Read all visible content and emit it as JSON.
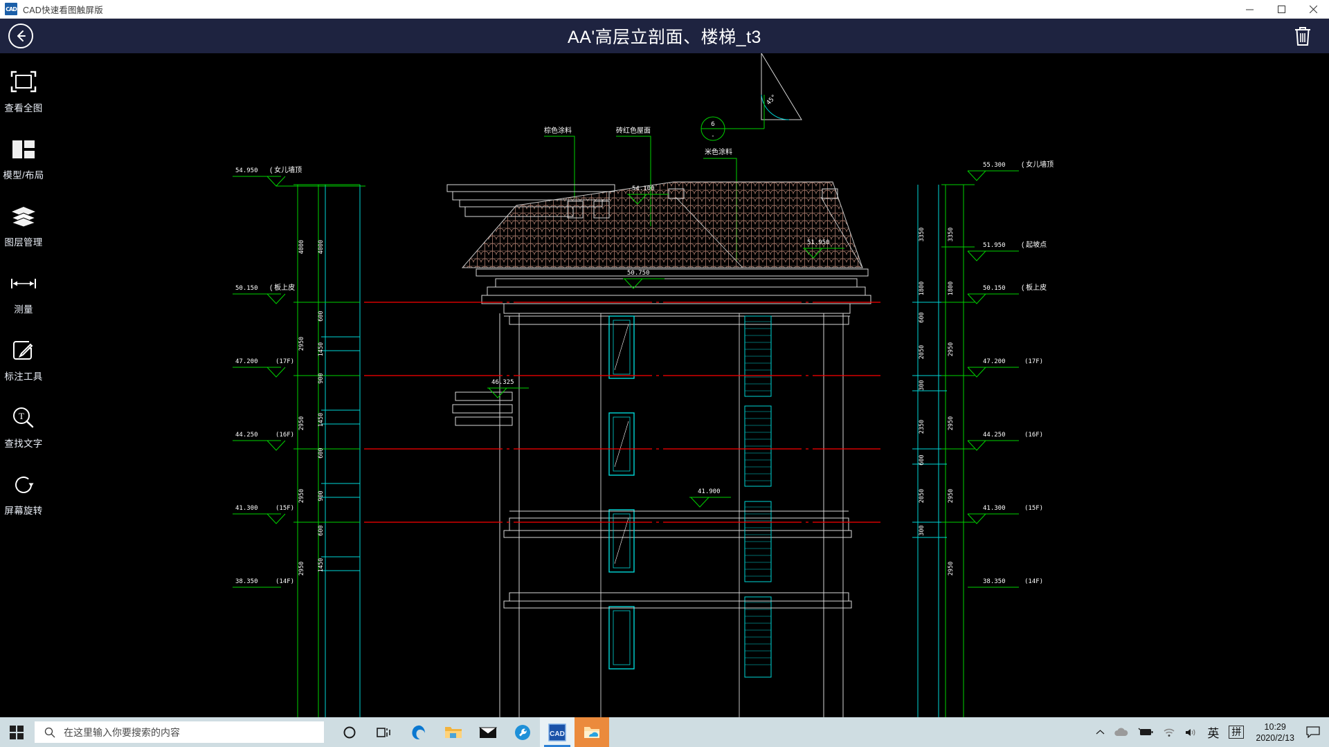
{
  "window": {
    "app_icon": "cad-app-icon",
    "title": "CAD快速看图触屏版",
    "minimize": "─",
    "maximize": "□",
    "close": "✕"
  },
  "header": {
    "back_icon": "back-arrow-icon",
    "title": "AA'高层立剖面、楼梯_t3",
    "delete_icon": "trash-icon"
  },
  "sidebar": {
    "items": [
      {
        "label": "查看全图",
        "icon": "fit-view-icon"
      },
      {
        "label": "模型/布局",
        "icon": "layout-icon"
      },
      {
        "label": "图层管理",
        "icon": "layers-icon"
      },
      {
        "label": "测量",
        "icon": "measure-icon"
      },
      {
        "label": "标注工具",
        "icon": "annotate-pencil-icon"
      },
      {
        "label": "查找文字",
        "icon": "find-text-icon"
      },
      {
        "label": "屏幕旋转",
        "icon": "rotate-screen-icon"
      }
    ]
  },
  "drawing": {
    "material_notes": [
      "棕色涂料",
      "砖红色屋面",
      "米色涂料"
    ],
    "callout_bubble": {
      "top": "6",
      "bottom": "-"
    },
    "slope_label": "45°",
    "left_levels": [
      {
        "value": "54.950",
        "note": "( 女儿墙顶"
      },
      {
        "value": "50.150",
        "note": "( 板上皮"
      },
      {
        "value": "47.200",
        "note": "(17F)"
      },
      {
        "value": "44.250",
        "note": "(16F)"
      },
      {
        "value": "41.300",
        "note": "(15F)"
      },
      {
        "value": "38.350",
        "note": "(14F)"
      }
    ],
    "right_levels": [
      {
        "value": "55.300",
        "note": "( 女儿墙顶"
      },
      {
        "value": "51.950",
        "note": "( 起坡点"
      },
      {
        "value": "50.150",
        "note": "( 板上皮"
      },
      {
        "value": "47.200",
        "note": "(17F)"
      },
      {
        "value": "44.250",
        "note": "(16F)"
      },
      {
        "value": "41.300",
        "note": "(15F)"
      },
      {
        "value": "38.350",
        "note": "(14F)"
      }
    ],
    "interior_levels": [
      "54.100",
      "51.950",
      "50.750",
      "46.325",
      "41.900"
    ],
    "left_dims_outer": [
      "4000",
      "2950",
      "2950",
      "2950",
      "2950"
    ],
    "left_dims_inner": [
      "4000",
      "600",
      "1450",
      "900",
      "600",
      "1450",
      "900",
      "600",
      "1450"
    ],
    "right_dims_inner": [
      "3350",
      "1800",
      "600",
      "2050",
      "300",
      "2350",
      "600",
      "2050",
      "300"
    ],
    "right_dims_outer": [
      "3350",
      "1800",
      "2950",
      "2950",
      "2950",
      "2950"
    ]
  },
  "taskbar": {
    "start_icon": "windows-start-icon",
    "search_icon": "search-icon",
    "search_placeholder": "在这里输入你要搜索的内容",
    "icons": [
      {
        "name": "cortana-icon"
      },
      {
        "name": "task-view-icon"
      },
      {
        "name": "edge-browser-icon"
      },
      {
        "name": "file-explorer-icon"
      },
      {
        "name": "mail-icon"
      },
      {
        "name": "tools-wrench-icon"
      },
      {
        "name": "cad-viewer-icon"
      },
      {
        "name": "onedrive-folder-icon"
      }
    ],
    "tray": {
      "chevron": "show-hidden-icons-icon",
      "onedrive": "onedrive-cloud-icon",
      "battery": "battery-icon",
      "network": "wifi-icon",
      "volume": "volume-icon",
      "ime_lang": "英",
      "ime_mode": "拼",
      "time": "10:29",
      "date": "2020/2/13",
      "action_center": "action-center-icon"
    }
  },
  "colors": {
    "header_bg": "#1e2340",
    "taskbar_bg": "#cfdde2",
    "cad_green": "#00d400",
    "cad_cyan": "#00d8d8",
    "cad_red": "#ff0000",
    "roof_brown": "#b08070"
  }
}
